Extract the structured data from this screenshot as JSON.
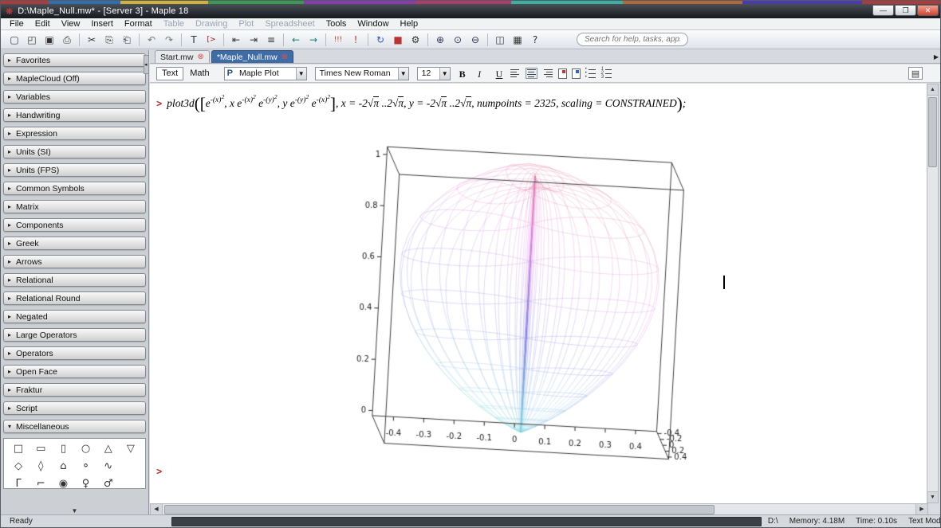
{
  "window": {
    "title": "D:\\Maple_Null.mw* - [Server 3] - Maple 18",
    "icon": "❋",
    "buttons": [
      {
        "name": "minimize-button",
        "glyph": "—"
      },
      {
        "name": "restore-button",
        "glyph": "❐"
      },
      {
        "name": "close-button",
        "glyph": "✕"
      }
    ]
  },
  "menu": {
    "items": [
      {
        "label": "File",
        "enabled": true
      },
      {
        "label": "Edit",
        "enabled": true
      },
      {
        "label": "View",
        "enabled": true
      },
      {
        "label": "Insert",
        "enabled": true
      },
      {
        "label": "Format",
        "enabled": true
      },
      {
        "label": "Table",
        "enabled": false
      },
      {
        "label": "Drawing",
        "enabled": false
      },
      {
        "label": "Plot",
        "enabled": false
      },
      {
        "label": "Spreadsheet",
        "enabled": false
      },
      {
        "label": "Tools",
        "enabled": true
      },
      {
        "label": "Window",
        "enabled": true
      },
      {
        "label": "Help",
        "enabled": true
      }
    ]
  },
  "toolbar": {
    "search_placeholder": "Search for help, tasks, apps...",
    "items": [
      {
        "name": "new-document",
        "glyph": "▢"
      },
      {
        "name": "open-file",
        "glyph": "◰"
      },
      {
        "name": "save-file",
        "glyph": "▣"
      },
      {
        "name": "print",
        "glyph": "⎙"
      },
      {
        "sep": true
      },
      {
        "name": "cut",
        "glyph": "✂"
      },
      {
        "name": "copy",
        "glyph": "⎘"
      },
      {
        "name": "paste",
        "glyph": "⎗"
      },
      {
        "sep": true
      },
      {
        "name": "undo",
        "glyph": "↶",
        "color": "#777"
      },
      {
        "name": "redo",
        "glyph": "↷",
        "color": "#777"
      },
      {
        "sep": true
      },
      {
        "name": "insert-text",
        "glyph": "T"
      },
      {
        "name": "insert-maple-input",
        "glyph": "[>",
        "color": "#8b1a1a"
      },
      {
        "sep": true
      },
      {
        "name": "indent-left",
        "glyph": "⇤"
      },
      {
        "name": "indent-right",
        "glyph": "⇥"
      },
      {
        "name": "justify",
        "glyph": "≡"
      },
      {
        "sep": true
      },
      {
        "name": "go-back",
        "glyph": "←",
        "color": "#167d7d"
      },
      {
        "name": "go-forward",
        "glyph": "→",
        "color": "#167d7d"
      },
      {
        "sep": true
      },
      {
        "name": "execute-all",
        "glyph": "!!!",
        "color": "#c0392b"
      },
      {
        "name": "execute",
        "glyph": "!",
        "color": "#c0392b"
      },
      {
        "sep": true
      },
      {
        "name": "restart-kernel",
        "glyph": "↻",
        "color": "#2a56c6"
      },
      {
        "name": "interrupt",
        "glyph": "■",
        "color": "#b33"
      },
      {
        "name": "debug",
        "glyph": "⚙"
      },
      {
        "sep": true
      },
      {
        "name": "zoom-in",
        "glyph": "⊕",
        "color": "#335"
      },
      {
        "name": "zoom-default",
        "glyph": "⊙",
        "color": "#335"
      },
      {
        "name": "zoom-out",
        "glyph": "⊖",
        "color": "#335"
      },
      {
        "sep": true
      },
      {
        "name": "split-view",
        "glyph": "◫"
      },
      {
        "name": "table-tools",
        "glyph": "▦"
      },
      {
        "name": "quick-help",
        "glyph": "?"
      }
    ]
  },
  "tabs": [
    {
      "label": "Start.mw",
      "active": false
    },
    {
      "label": "*Maple_Null.mw",
      "active": true
    }
  ],
  "format_toolbar": {
    "text_label": "Text",
    "math_label": "Math",
    "style_icon": "P",
    "style": "Maple Plot",
    "font": "Times New Roman",
    "size": "12",
    "bold": "B",
    "italic": "I",
    "underline": "U"
  },
  "sidebar": {
    "palettes": [
      {
        "label": "Favorites",
        "expanded": false
      },
      {
        "label": "MapleCloud (Off)",
        "expanded": false
      },
      {
        "label": "Variables",
        "expanded": false
      },
      {
        "label": "Handwriting",
        "expanded": false
      },
      {
        "label": "Expression",
        "expanded": false
      },
      {
        "label": "Units (SI)",
        "expanded": false
      },
      {
        "label": "Units (FPS)",
        "expanded": false
      },
      {
        "label": "Common Symbols",
        "expanded": false
      },
      {
        "label": "Matrix",
        "expanded": false
      },
      {
        "label": "Components",
        "expanded": false
      },
      {
        "label": "Greek",
        "expanded": false
      },
      {
        "label": "Arrows",
        "expanded": false
      },
      {
        "label": "Relational",
        "expanded": false
      },
      {
        "label": "Relational Round",
        "expanded": false
      },
      {
        "label": "Negated",
        "expanded": false
      },
      {
        "label": "Large Operators",
        "expanded": false
      },
      {
        "label": "Operators",
        "expanded": false
      },
      {
        "label": "Open Face",
        "expanded": false
      },
      {
        "label": "Fraktur",
        "expanded": false
      },
      {
        "label": "Script",
        "expanded": false
      },
      {
        "label": "Miscellaneous",
        "expanded": true
      }
    ],
    "shapes": [
      [
        "□",
        "▭",
        "▯",
        "○",
        "△",
        "▽"
      ],
      [
        "◇",
        "◊",
        "⌂",
        "⚬",
        "∿",
        ""
      ],
      [
        "Γ",
        "⌐",
        "◉",
        "♀",
        "♂",
        ""
      ]
    ]
  },
  "document": {
    "prompt": ">",
    "prompt2": ">",
    "math_tokens": [
      {
        "t": "fn",
        "v": "plot3d"
      },
      {
        "t": "big",
        "v": "(["
      },
      {
        "t": "i",
        "v": "e"
      },
      {
        "t": "sup",
        "v": "-(x)"
      },
      {
        "t": "sup2",
        "v": "2"
      },
      {
        "t": "p",
        "v": ", "
      },
      {
        "t": "i",
        "v": "x e"
      },
      {
        "t": "sup",
        "v": "-(x)"
      },
      {
        "t": "sup2",
        "v": "2"
      },
      {
        "t": "i",
        "v": " e"
      },
      {
        "t": "sup",
        "v": "-(y)"
      },
      {
        "t": "sup2",
        "v": "2"
      },
      {
        "t": "p",
        "v": ", "
      },
      {
        "t": "i",
        "v": "y e"
      },
      {
        "t": "sup",
        "v": "-(y)"
      },
      {
        "t": "sup2",
        "v": "2"
      },
      {
        "t": "i",
        "v": " e"
      },
      {
        "t": "sup",
        "v": "-(x)"
      },
      {
        "t": "sup2",
        "v": "2"
      },
      {
        "t": "big",
        "v": "]"
      },
      {
        "t": "p",
        "v": ", "
      },
      {
        "t": "i",
        "v": "x"
      },
      {
        "t": "p",
        "v": " = -2"
      },
      {
        "t": "sqrt",
        "v": "π"
      },
      {
        "t": "p",
        "v": " ..2"
      },
      {
        "t": "sqrt",
        "v": "π"
      },
      {
        "t": "p",
        "v": ", "
      },
      {
        "t": "i",
        "v": "y"
      },
      {
        "t": "p",
        "v": " = -2"
      },
      {
        "t": "sqrt",
        "v": "π"
      },
      {
        "t": "p",
        "v": " ..2"
      },
      {
        "t": "sqrt",
        "v": "π"
      },
      {
        "t": "p",
        "v": ", "
      },
      {
        "t": "i",
        "v": "numpoints"
      },
      {
        "t": "p",
        "v": " = 2325, "
      },
      {
        "t": "i",
        "v": "scaling"
      },
      {
        "t": "p",
        "v": " = "
      },
      {
        "t": "i",
        "v": "CONSTRAINED"
      },
      {
        "t": "big",
        "v": ")"
      },
      {
        "t": "p",
        "v": ";"
      }
    ]
  },
  "plot": {
    "type": "3d-parametric-wireframe",
    "expression": "plot3d([exp(-x^2), x*exp(-x^2)*exp(-y^2), y*exp(-y^2)*exp(-x^2)], x=-2*sqrt(Pi)..2*sqrt(Pi), y=-2*sqrt(Pi)..2*sqrt(Pi), numpoints=2325, scaling=CONSTRAINED)",
    "param_range": 3.5449,
    "grid_lines": 40,
    "samples": 90,
    "z_ticks": [
      0,
      0.2,
      0.4,
      0.6,
      0.8,
      1
    ],
    "x_ticks": [
      -0.4,
      -0.3,
      -0.2,
      -0.1,
      0,
      0.1,
      0.2,
      0.3,
      0.4
    ],
    "y_ticks": [
      -0.4,
      -0.2,
      0,
      0.2,
      0.4
    ],
    "x_range": [
      -0.47,
      0.47
    ],
    "y_range": [
      -0.47,
      0.47
    ],
    "z_range": [
      0,
      1
    ]
  },
  "status": {
    "ready": "Ready",
    "drive": "D:\\",
    "memory": "Memory: 4.18M",
    "time": "Time: 0.10s",
    "mode": "Text Mode"
  }
}
